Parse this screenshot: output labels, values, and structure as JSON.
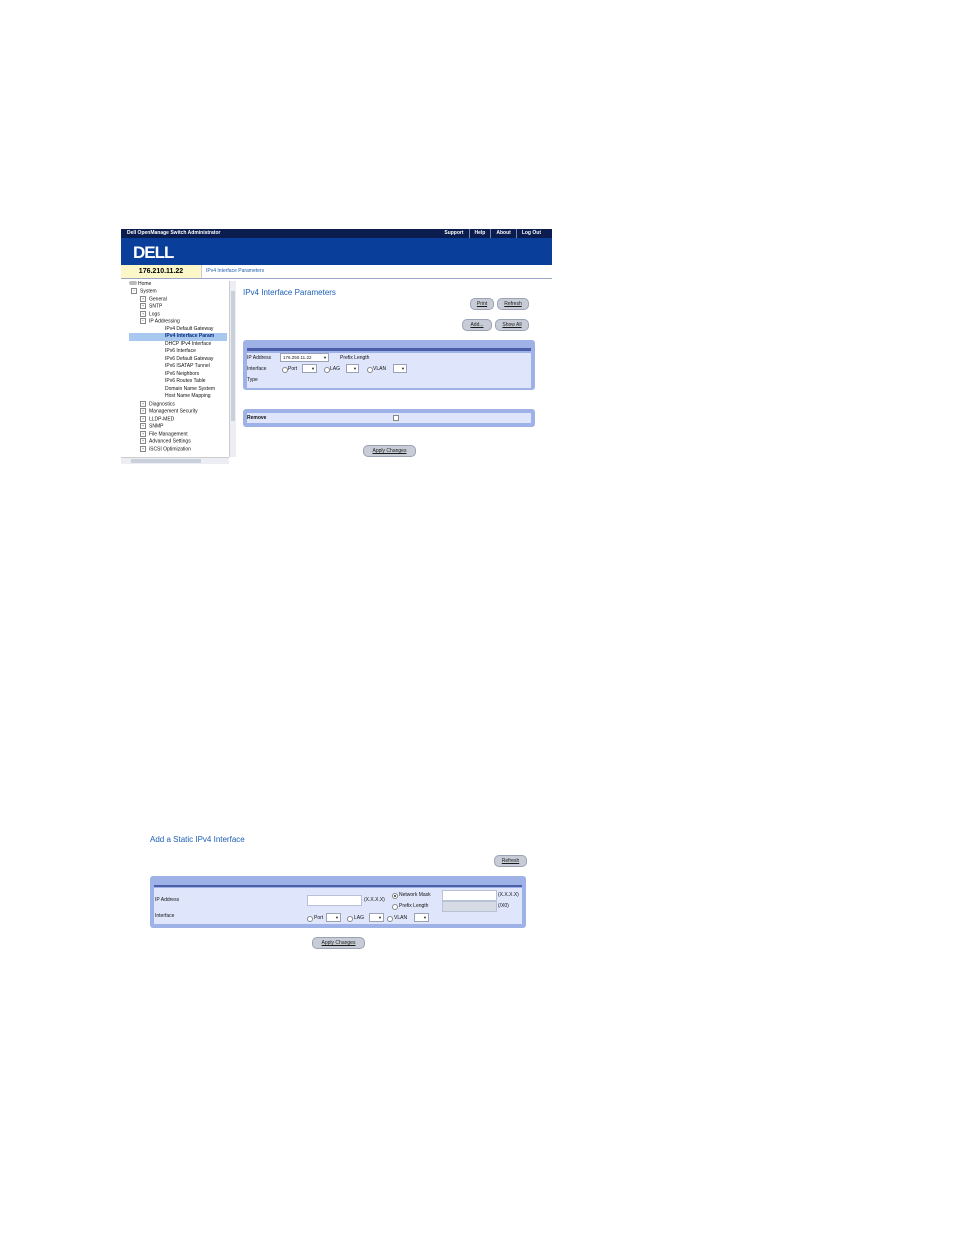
{
  "screen1": {
    "topbar": {
      "app_title": "Dell OpenManage Switch Administrator",
      "links": [
        "Support",
        "Help",
        "About",
        "Log Out"
      ]
    },
    "logo": "DELL",
    "ip": "176.210.11.22",
    "breadcrumb": "IPv4 Interface Parameters",
    "tree": {
      "root": "Home",
      "items": [
        "System",
        "General",
        "SNTP",
        "Logs",
        "IP Addressing",
        "IPv4 Default Gateway",
        "IPv4 Interface Param",
        "DHCP IPv4 Interface",
        "IPv6 Interface",
        "IPv6 Default Gateway",
        "IPv6 ISATAP Tunnel",
        "IPv6 Neighbors",
        "IPv6 Routes Table",
        "Domain Name System",
        "Host Name Mapping",
        "Diagnostics",
        "Management Security",
        "LLDP-MED",
        "SNMP",
        "File Management",
        "Advanced Settings",
        "iSCSI Optimization"
      ],
      "selected": "IPv4 Interface Param"
    },
    "page_title": "IPv4 Interface Parameters",
    "buttons": {
      "print": "Print",
      "refresh": "Refresh",
      "add": "Add...",
      "show_all": "Show All",
      "apply": "Apply Changes"
    },
    "form": {
      "ip_address_label": "IP Address",
      "ip_address_value": "176.250.11.22",
      "prefix_length_label": "Prefix Length",
      "interface_label": "Interface",
      "port_label": "Port",
      "lag_label": "LAG",
      "vlan_label": "VLAN",
      "type_label": "Type",
      "remove_label": "Remove"
    }
  },
  "screen2": {
    "title": "Add a Static IPv4 Interface",
    "refresh": "Refresh",
    "ip_address_label": "IP Address",
    "ip_format": "(X.X.X.X)",
    "network_mask_label": "Network Mask",
    "mask_format": "(X.X.X.X)",
    "prefix_length_label": "Prefix Length",
    "prefix_format": "(/X0)",
    "interface_label": "Interface",
    "port_label": "Port",
    "lag_label": "LAG",
    "vlan_label": "VLAN",
    "apply": "Apply Changes"
  }
}
